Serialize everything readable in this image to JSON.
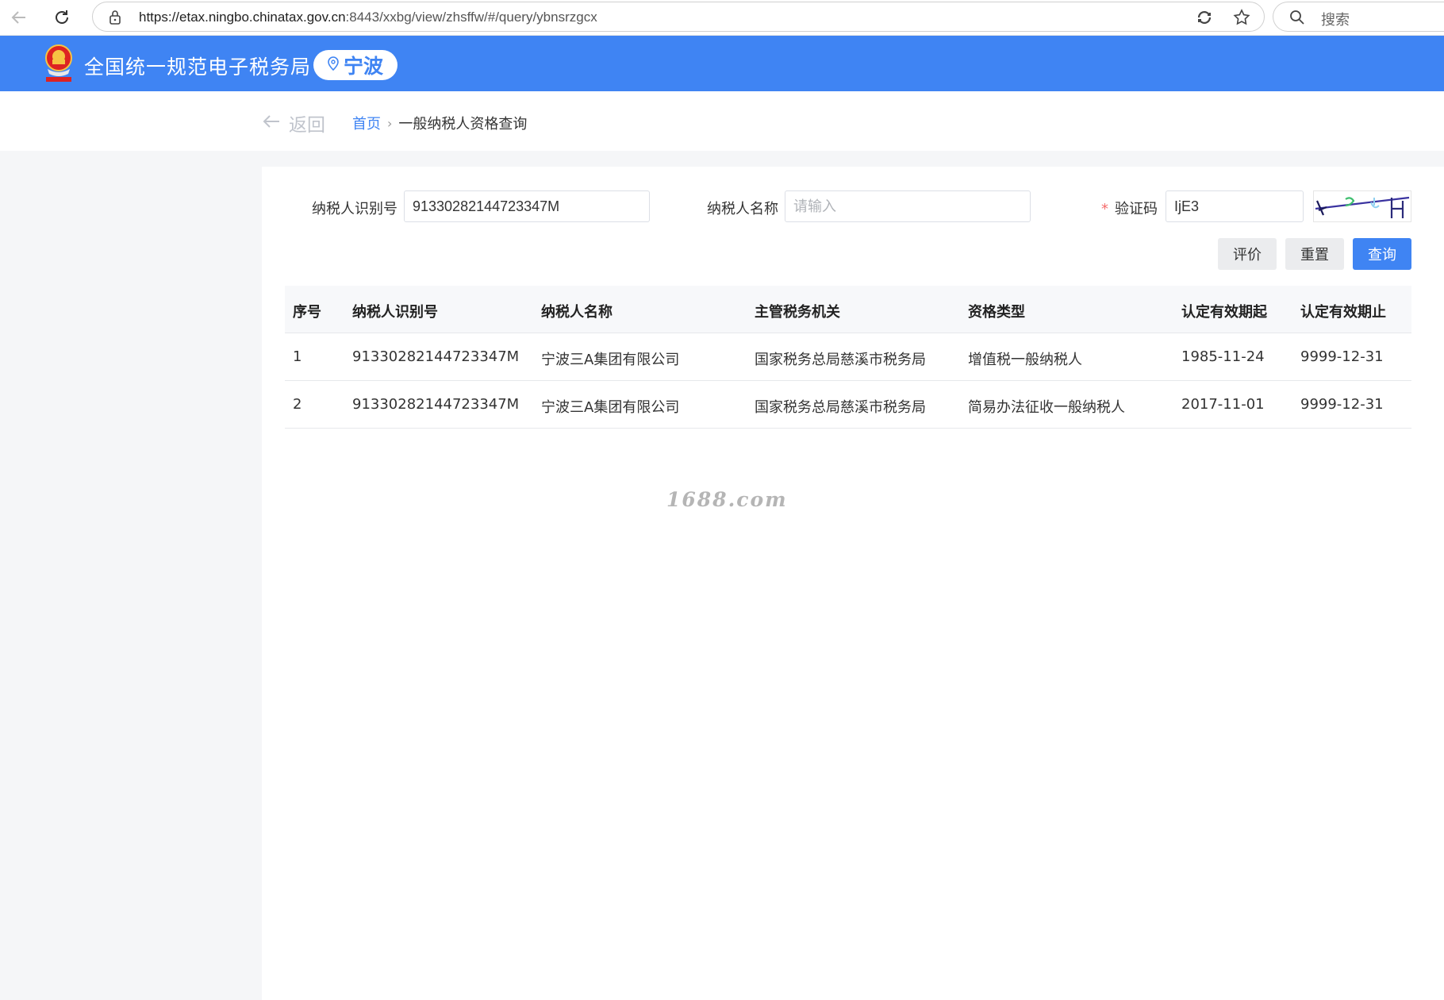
{
  "browser": {
    "url_host": "https://etax.ningbo.chinatax.gov.cn",
    "url_rest": ":8443/xxbg/view/zhsffw/#/query/ybnsrzgcx",
    "search_label": "搜索"
  },
  "header": {
    "site_title": "全国统一规范电子税务局",
    "city": "宁波"
  },
  "breadcrumb": {
    "back_label": "返回",
    "home": "首页",
    "current": "一般纳税人资格查询"
  },
  "form": {
    "taxpayer_id_label": "纳税人识别号",
    "taxpayer_id_value": "91330282144723347M",
    "taxpayer_name_label": "纳税人名称",
    "taxpayer_name_placeholder": "请输入",
    "captcha_required_mark": "*",
    "captcha_label": "验证码",
    "captcha_value": "IjE3"
  },
  "buttons": {
    "evaluate": "评价",
    "reset": "重置",
    "query": "查询"
  },
  "table": {
    "headers": [
      "序号",
      "纳税人识别号",
      "纳税人名称",
      "主管税务机关",
      "资格类型",
      "认定有效期起",
      "认定有效期止"
    ],
    "rows": [
      [
        "1",
        "91330282144723347M",
        "宁波三A集团有限公司",
        "国家税务总局慈溪市税务局",
        "增值税一般纳税人",
        "1985-11-24",
        "9999-12-31"
      ],
      [
        "2",
        "91330282144723347M",
        "宁波三A集团有限公司",
        "国家税务总局慈溪市税务局",
        "简易办法征收一般纳税人",
        "2017-11-01",
        "9999-12-31"
      ]
    ]
  },
  "watermark": "1688.com",
  "colors": {
    "primary": "#3f84f3",
    "required": "#f56c6c",
    "page_bg": "#f5f6f8"
  }
}
